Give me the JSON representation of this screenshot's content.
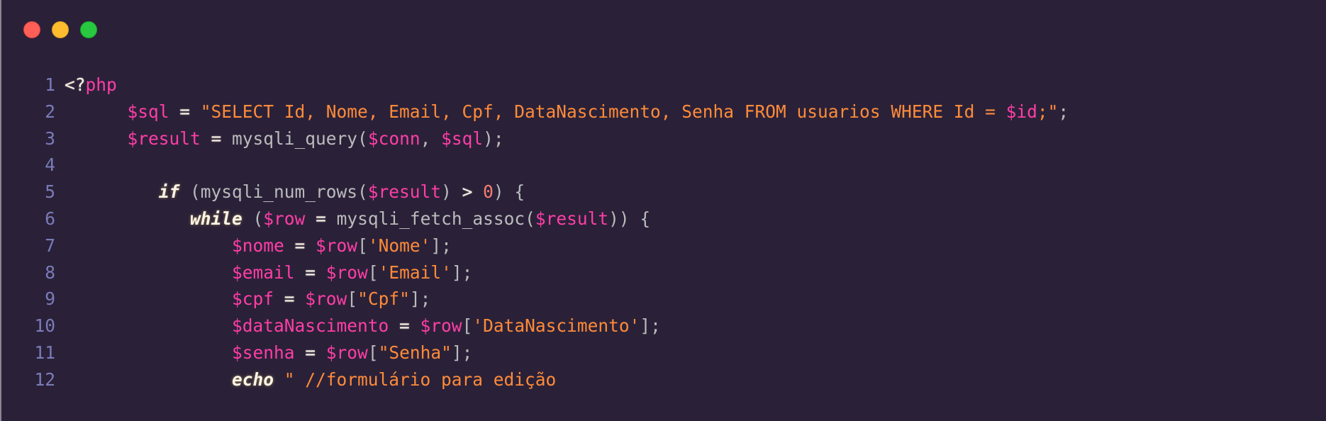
{
  "window": {
    "buttons": [
      {
        "name": "close",
        "color": "#ff5f57"
      },
      {
        "name": "minimize",
        "color": "#febc2e"
      },
      {
        "name": "maximize",
        "color": "#28c840"
      }
    ]
  },
  "code": {
    "language": "php",
    "lines": [
      {
        "n": "1",
        "tokens": [
          {
            "t": "<?",
            "c": "o"
          },
          {
            "t": "php",
            "c": "v"
          }
        ]
      },
      {
        "n": "2",
        "tokens": [
          {
            "t": "      ",
            "c": "pl"
          },
          {
            "t": "$sql",
            "c": "v"
          },
          {
            "t": " = ",
            "c": "o"
          },
          {
            "t": "\"SELECT Id, Nome, Email, Cpf, DataNascimento, Senha FROM usuarios WHERE Id = ",
            "c": "s"
          },
          {
            "t": "$id",
            "c": "v"
          },
          {
            "t": ";\"",
            "c": "s"
          },
          {
            "t": ";",
            "c": "pl"
          }
        ]
      },
      {
        "n": "3",
        "tokens": [
          {
            "t": "      ",
            "c": "pl"
          },
          {
            "t": "$result",
            "c": "v"
          },
          {
            "t": " = ",
            "c": "o"
          },
          {
            "t": "mysqli_query(",
            "c": "pl"
          },
          {
            "t": "$conn",
            "c": "v"
          },
          {
            "t": ", ",
            "c": "pl"
          },
          {
            "t": "$sql",
            "c": "v"
          },
          {
            "t": ");",
            "c": "pl"
          }
        ]
      },
      {
        "n": "4",
        "tokens": []
      },
      {
        "n": "5",
        "tokens": [
          {
            "t": "         ",
            "c": "pl"
          },
          {
            "t": "if",
            "c": "k"
          },
          {
            "t": " (mysqli_num_rows(",
            "c": "pl"
          },
          {
            "t": "$result",
            "c": "v"
          },
          {
            "t": ") ",
            "c": "pl"
          },
          {
            "t": ">",
            "c": "o"
          },
          {
            "t": " ",
            "c": "pl"
          },
          {
            "t": "0",
            "c": "n"
          },
          {
            "t": ") {",
            "c": "pl"
          }
        ]
      },
      {
        "n": "6",
        "tokens": [
          {
            "t": "            ",
            "c": "pl"
          },
          {
            "t": "while",
            "c": "k"
          },
          {
            "t": " (",
            "c": "pl"
          },
          {
            "t": "$row",
            "c": "v"
          },
          {
            "t": " = ",
            "c": "o"
          },
          {
            "t": "mysqli_fetch_assoc(",
            "c": "pl"
          },
          {
            "t": "$result",
            "c": "v"
          },
          {
            "t": ")) {",
            "c": "pl"
          }
        ]
      },
      {
        "n": "7",
        "tokens": [
          {
            "t": "                ",
            "c": "pl"
          },
          {
            "t": "$nome",
            "c": "v"
          },
          {
            "t": " = ",
            "c": "o"
          },
          {
            "t": "$row",
            "c": "v"
          },
          {
            "t": "[",
            "c": "pl"
          },
          {
            "t": "'Nome'",
            "c": "s"
          },
          {
            "t": "];",
            "c": "pl"
          }
        ]
      },
      {
        "n": "8",
        "tokens": [
          {
            "t": "                ",
            "c": "pl"
          },
          {
            "t": "$email",
            "c": "v"
          },
          {
            "t": " = ",
            "c": "o"
          },
          {
            "t": "$row",
            "c": "v"
          },
          {
            "t": "[",
            "c": "pl"
          },
          {
            "t": "'Email'",
            "c": "s"
          },
          {
            "t": "];",
            "c": "pl"
          }
        ]
      },
      {
        "n": "9",
        "tokens": [
          {
            "t": "                ",
            "c": "pl"
          },
          {
            "t": "$cpf",
            "c": "v"
          },
          {
            "t": " = ",
            "c": "o"
          },
          {
            "t": "$row",
            "c": "v"
          },
          {
            "t": "[",
            "c": "pl"
          },
          {
            "t": "\"Cpf\"",
            "c": "s"
          },
          {
            "t": "];",
            "c": "pl"
          }
        ]
      },
      {
        "n": "10",
        "tokens": [
          {
            "t": "                ",
            "c": "pl"
          },
          {
            "t": "$dataNascimento",
            "c": "v"
          },
          {
            "t": " = ",
            "c": "o"
          },
          {
            "t": "$row",
            "c": "v"
          },
          {
            "t": "[",
            "c": "pl"
          },
          {
            "t": "'DataNascimento'",
            "c": "s"
          },
          {
            "t": "];",
            "c": "pl"
          }
        ]
      },
      {
        "n": "11",
        "tokens": [
          {
            "t": "                ",
            "c": "pl"
          },
          {
            "t": "$senha",
            "c": "v"
          },
          {
            "t": " = ",
            "c": "o"
          },
          {
            "t": "$row",
            "c": "v"
          },
          {
            "t": "[",
            "c": "pl"
          },
          {
            "t": "\"Senha\"",
            "c": "s"
          },
          {
            "t": "];",
            "c": "pl"
          }
        ]
      },
      {
        "n": "12",
        "tokens": [
          {
            "t": "                ",
            "c": "pl"
          },
          {
            "t": "echo",
            "c": "k"
          },
          {
            "t": " \" //formulário para edição",
            "c": "s"
          }
        ]
      }
    ]
  }
}
